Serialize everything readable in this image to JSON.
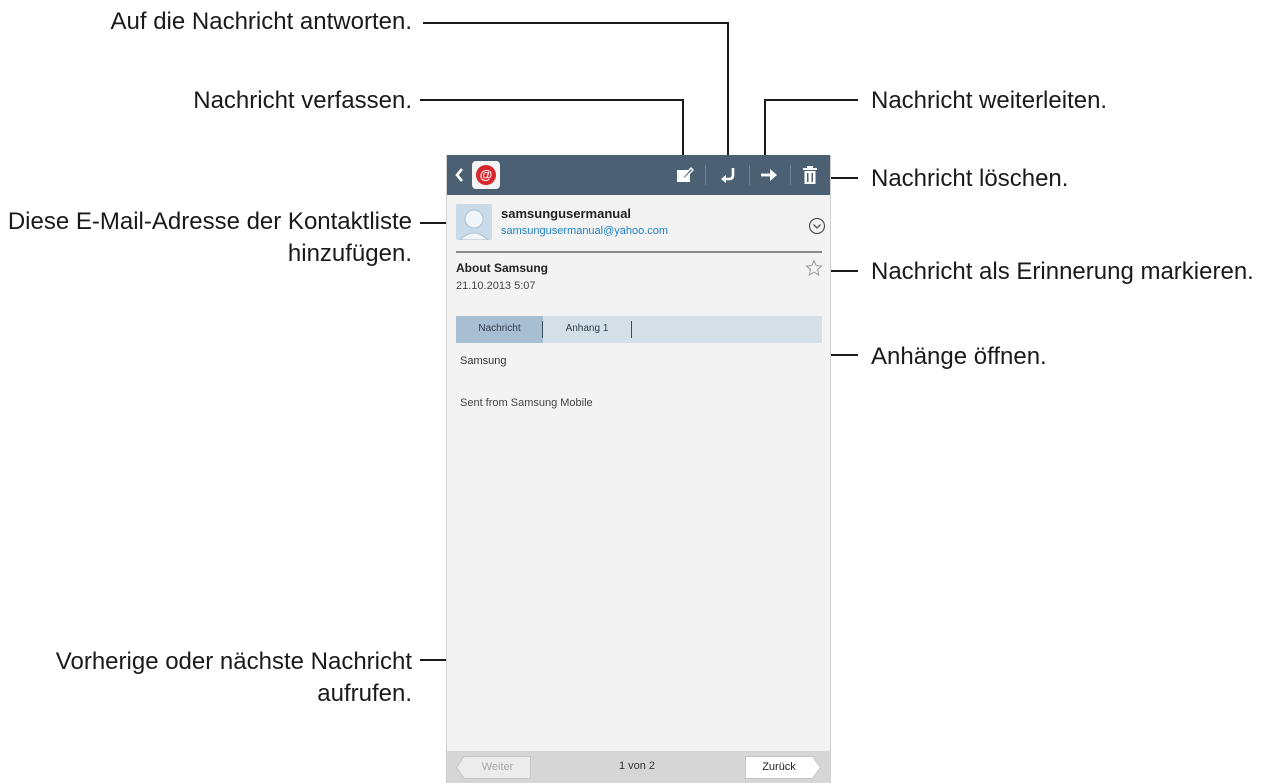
{
  "callouts": {
    "reply": "Auf die Nachricht antworten.",
    "compose": "Nachricht verfassen.",
    "forward": "Nachricht weiterleiten.",
    "delete": "Nachricht löschen.",
    "add_contact_line1": "Diese E-Mail-Adresse der Kontaktliste",
    "add_contact_line2": "hinzufügen.",
    "mark_reminder": "Nachricht als Erinnerung markieren.",
    "open_attachments": "Anhänge öffnen.",
    "prev_next_line1": "Vorherige oder nächste Nachricht",
    "prev_next_line2": "aufrufen."
  },
  "actionbar": {
    "background": "#4c6074",
    "icons": [
      "back-chevron-icon",
      "email-app-icon",
      "compose-icon",
      "reply-icon",
      "forward-icon",
      "delete-icon"
    ]
  },
  "sender": {
    "name": "samsungusermanual",
    "email": "samsungusermanual@yahoo.com",
    "email_color": "#1f7fc8"
  },
  "message": {
    "subject": "About Samsung",
    "date": "21.10.2013 5:07",
    "body_line1": "Samsung",
    "body_line2": "Sent from Samsung Mobile"
  },
  "tabs": {
    "message_label": "Nachricht",
    "attachment_label": "Anhang 1"
  },
  "bottombar": {
    "prev_label": "Weiter",
    "page_indicator": "1 von 2",
    "next_label": "Zurück"
  }
}
